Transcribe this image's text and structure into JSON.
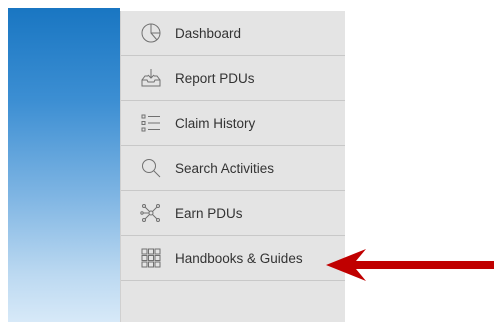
{
  "sidebar": {
    "items": [
      {
        "label": "Dashboard",
        "icon": "pie-chart-icon"
      },
      {
        "label": "Report PDUs",
        "icon": "tray-download-icon"
      },
      {
        "label": "Claim History",
        "icon": "list-icon"
      },
      {
        "label": "Search Activities",
        "icon": "search-icon"
      },
      {
        "label": "Earn PDUs",
        "icon": "network-nodes-icon"
      },
      {
        "label": "Handbooks & Guides",
        "icon": "grid-icon"
      }
    ]
  },
  "colors": {
    "arrow": "#c00000",
    "sidebar_bg": "#e4e4e4",
    "panel_top": "#1976c2"
  }
}
